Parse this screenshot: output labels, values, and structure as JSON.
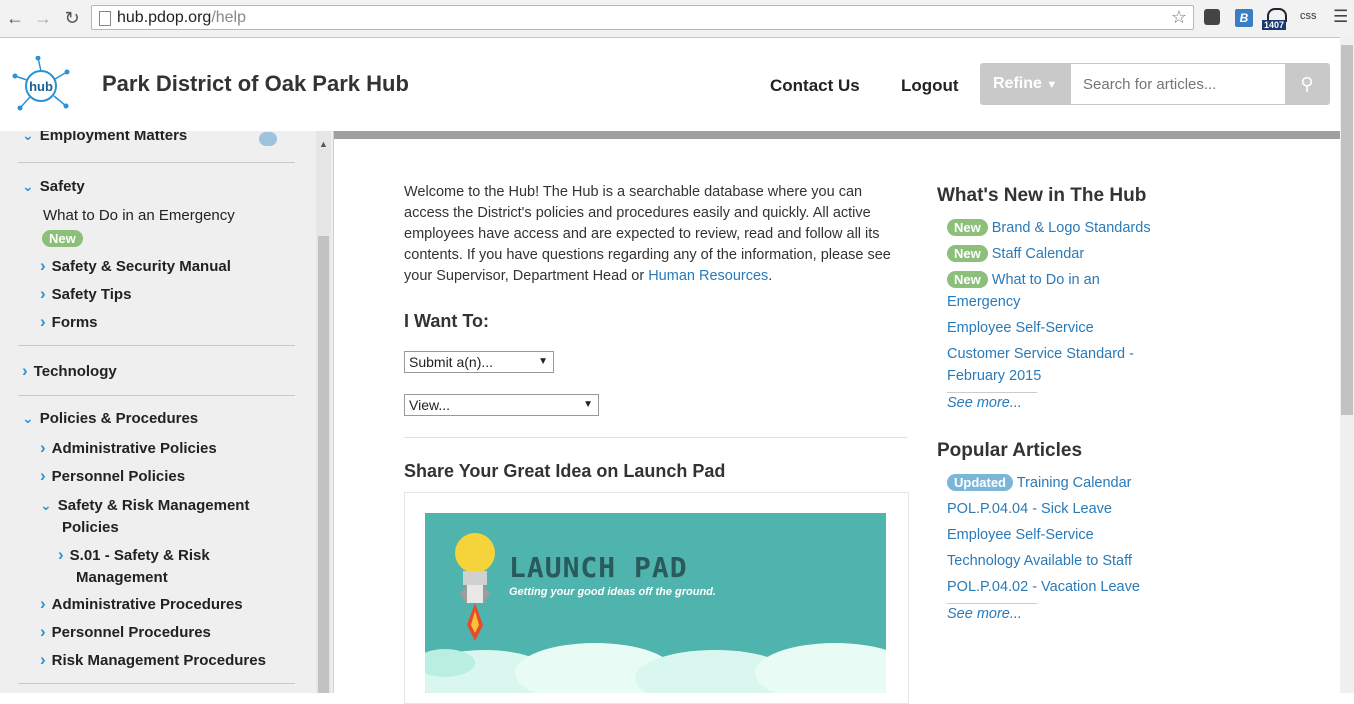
{
  "browser": {
    "url_host": "hub.pdop.org",
    "url_path": "/help",
    "ext_badge": "1407",
    "ext_css": "css"
  },
  "header": {
    "logo_text": "hub",
    "title": "Park District of Oak Park Hub",
    "contact": "Contact Us",
    "logout": "Logout",
    "refine": "Refine",
    "search_placeholder": "Search for articles..."
  },
  "sidebar": {
    "employment": "Employment Matters",
    "safety": "Safety",
    "what_to_do": "What to Do in an Emergency",
    "new_badge": "New",
    "safety_manual": "Safety & Security Manual",
    "safety_tips": "Safety Tips",
    "forms": "Forms",
    "technology": "Technology",
    "policies": "Policies & Procedures",
    "admin_policies": "Administrative Policies",
    "personnel_policies": "Personnel Policies",
    "safety_risk_1": "Safety & Risk Management",
    "safety_risk_2": "Policies",
    "s01_1": "S.01 - Safety & Risk",
    "s01_2": "Management",
    "admin_procedures": "Administrative Procedures",
    "personnel_procedures": "Personnel Procedures",
    "risk_procedures": "Risk Management Procedures"
  },
  "main": {
    "intro_1": "Welcome to the Hub! The Hub is a searchable database where you can access the District's policies and procedures easily and quickly. All active employees have access and are expected to review, read and follow all its contents. If you have questions regarding any of the information, please see your Supervisor, Department Head or ",
    "intro_link": "Human Resources",
    "intro_end": ".",
    "i_want": "I Want To:",
    "submit_select": "Submit a(n)...",
    "view_select": "View...",
    "share_heading": "Share Your Great Idea on Launch Pad",
    "lp_title": "LAUNCH PAD",
    "lp_sub": "Getting your good ideas off the ground."
  },
  "whats_new": {
    "heading": "What's New in The Hub",
    "badge": "New",
    "item1": "Brand & Logo Standards",
    "item2": "Staff Calendar",
    "item3": "What to Do in an Emergency",
    "item4": "Employee Self-Service",
    "item5": "Customer Service Standard - February 2015",
    "see_more": "See more..."
  },
  "popular": {
    "heading": "Popular Articles",
    "badge": "Updated",
    "item1": "Training Calendar",
    "item2": "POL.P.04.04 - Sick Leave",
    "item3": "Employee Self-Service",
    "item4": "Technology Available to Staff",
    "item5": "POL.P.04.02 - Vacation Leave",
    "see_more": "See more..."
  }
}
